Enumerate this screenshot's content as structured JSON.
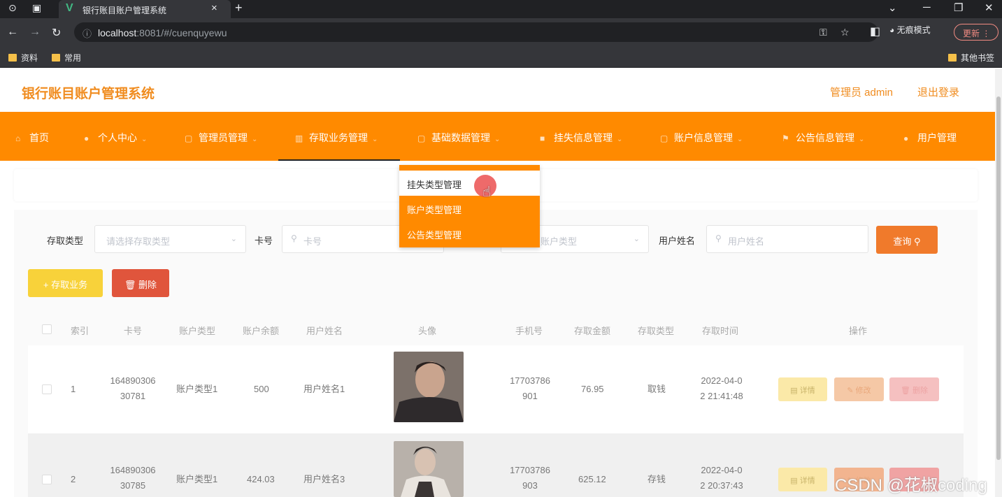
{
  "browser": {
    "tab_title": "银行账目账户管理系统",
    "tab_close": "×",
    "tab_new": "+",
    "url_host": "localhost",
    "url_rest": ":8081/#/cuenquyewu",
    "incognito_label": "无痕模式",
    "update_label": "更新",
    "bookmarks": [
      "资料",
      "常用"
    ],
    "other_bookmarks": "其他书签"
  },
  "header": {
    "title": "银行账目账户管理系统",
    "user_role": "管理员 admin",
    "logout": "退出登录"
  },
  "menu": {
    "items": [
      {
        "label": "首页",
        "icon": "home-icon"
      },
      {
        "label": "个人中心",
        "icon": "user-icon"
      },
      {
        "label": "管理员管理",
        "icon": "admin-icon"
      },
      {
        "label": "存取业务管理",
        "icon": "chart-icon"
      },
      {
        "label": "基础数据管理",
        "icon": "data-icon"
      },
      {
        "label": "挂失信息管理",
        "icon": "report-icon"
      },
      {
        "label": "账户信息管理",
        "icon": "account-icon"
      },
      {
        "label": "公告信息管理",
        "icon": "flag-icon"
      },
      {
        "label": "用户管理",
        "icon": "users-icon"
      }
    ],
    "dropdown": [
      "挂失类型管理",
      "账户类型管理",
      "公告类型管理"
    ]
  },
  "search": {
    "type_label": "存取类型",
    "type_placeholder": "请选择存取类型",
    "card_label": "卡号",
    "card_placeholder": "卡号",
    "account_type_placeholder": "账户类型",
    "name_label": "用户姓名",
    "name_placeholder": "用户姓名",
    "query_button": "查询"
  },
  "actions": {
    "add_button": "存取业务",
    "delete_button": "删除"
  },
  "table": {
    "headers": [
      "索引",
      "卡号",
      "账户类型",
      "账户余额",
      "用户姓名",
      "头像",
      "手机号",
      "存取金额",
      "存取类型",
      "存取时间",
      "操作"
    ],
    "rows": [
      {
        "index": "1",
        "card_l1": "164890306",
        "card_l2": "30781",
        "account_type": "账户类型1",
        "balance": "500",
        "name": "用户姓名1",
        "phone_l1": "17703786",
        "phone_l2": "901",
        "amount": "76.95",
        "type": "取钱",
        "time_l1": "2022-04-0",
        "time_l2": "2 21:41:48"
      },
      {
        "index": "2",
        "card_l1": "164890306",
        "card_l2": "30785",
        "account_type": "账户类型1",
        "balance": "424.03",
        "name": "用户姓名3",
        "phone_l1": "17703786",
        "phone_l2": "903",
        "amount": "625.12",
        "type": "存钱",
        "time_l1": "2022-04-0",
        "time_l2": "2 20:37:43"
      }
    ],
    "op_detail": "详情",
    "op_edit": "修改",
    "op_delete": "删除"
  },
  "watermark": "CSDN @花椒coding",
  "colors": {
    "accent": "#ff8a00",
    "title": "#f08c1f",
    "query": "#f07a2b",
    "add": "#f8d23a",
    "delete": "#e0553c"
  }
}
